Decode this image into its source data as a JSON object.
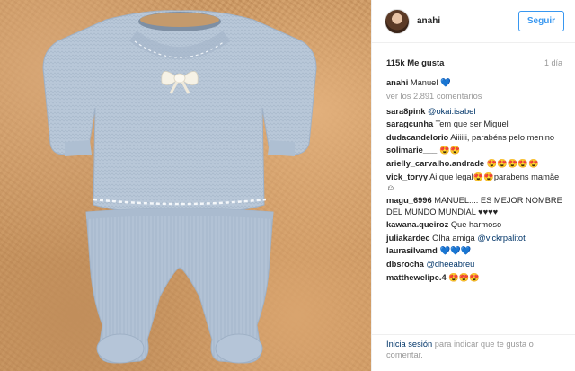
{
  "post": {
    "owner": "anahi",
    "follow_label": "Seguir",
    "likes": "115k Me gusta",
    "time_ago": "1 día",
    "caption": {
      "user": "anahi",
      "text": "Manuel 💙"
    },
    "view_all": "ver los 2.891 comentarios"
  },
  "comments": [
    {
      "user": "sara8pink",
      "text": "",
      "mention": "@okai.isabel"
    },
    {
      "user": "saragcunha",
      "text": "Tem que ser Miguel",
      "mention": ""
    },
    {
      "user": "dudacandelorio",
      "text": "Aiiiiii, parabéns pelo menino",
      "mention": ""
    },
    {
      "user": "solimarie___",
      "text": "😍😍",
      "mention": ""
    },
    {
      "user": "arielly_carvalho.andrade",
      "text": "😍😍😍😍😍",
      "mention": ""
    },
    {
      "user": "vick_toryy",
      "text": "Ai que legal😍😍parabens mamãe☺",
      "mention": ""
    },
    {
      "user": "magu_6996",
      "text": "MANUEL.... ES MEJOR NOMBRE DEL MUNDO MUNDIAL ♥♥♥♥",
      "mention": ""
    },
    {
      "user": "kawana.queiroz",
      "text": "Que harmoso",
      "mention": ""
    },
    {
      "user": "juliakardec",
      "text": "Olha amiga",
      "mention": "@vickrpalitot"
    },
    {
      "user": "laurasilvamd",
      "text": "💙💙💙",
      "mention": ""
    },
    {
      "user": "dbsrocha",
      "text": "",
      "mention": "@dheeabreu"
    },
    {
      "user": "matthewelipe.4",
      "text": "😍😍😍",
      "mention": ""
    }
  ],
  "footer": {
    "login_label": "Inicia sesión",
    "rest": " para indicar que te gusta o comentar."
  },
  "colors": {
    "accent": "#3897f0",
    "mention": "#003569",
    "muted": "#999999",
    "knit": "#b8c7d8"
  }
}
